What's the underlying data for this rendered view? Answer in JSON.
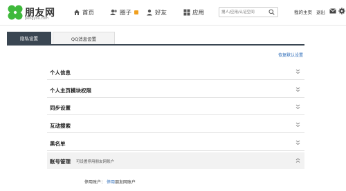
{
  "header": {
    "logo_text": "朋友网",
    "logo_sub": "pengyou.com",
    "nav": [
      {
        "label": "首页",
        "icon": "home-icon"
      },
      {
        "label": "圈子",
        "icon": "group-icon"
      },
      {
        "label": "好友",
        "icon": "friend-icon"
      },
      {
        "label": "应用",
        "icon": "apps-icon"
      }
    ],
    "search_placeholder": "搜人/应用/认证空间",
    "my_home": "我的主页",
    "logout": "退出"
  },
  "tabs": [
    {
      "label": "隐私设置",
      "active": true
    },
    {
      "label": "QQ消息设置",
      "active": false
    }
  ],
  "restore_default": "恢复默认设置",
  "sections": [
    {
      "title": "个人信息"
    },
    {
      "title": "个人主页模块权限"
    },
    {
      "title": "同步设置"
    },
    {
      "title": "互动搜索"
    },
    {
      "title": "黑名单"
    },
    {
      "title": "账号管理",
      "desc": "可设置停用朋友网账户"
    }
  ],
  "account": {
    "label": "停用账户：",
    "action": "停用",
    "text": "朋友网账户"
  },
  "colors": {
    "accent_dark": "#3a4652",
    "link": "#2a6ab8",
    "logo_green": "#3fb93c"
  }
}
